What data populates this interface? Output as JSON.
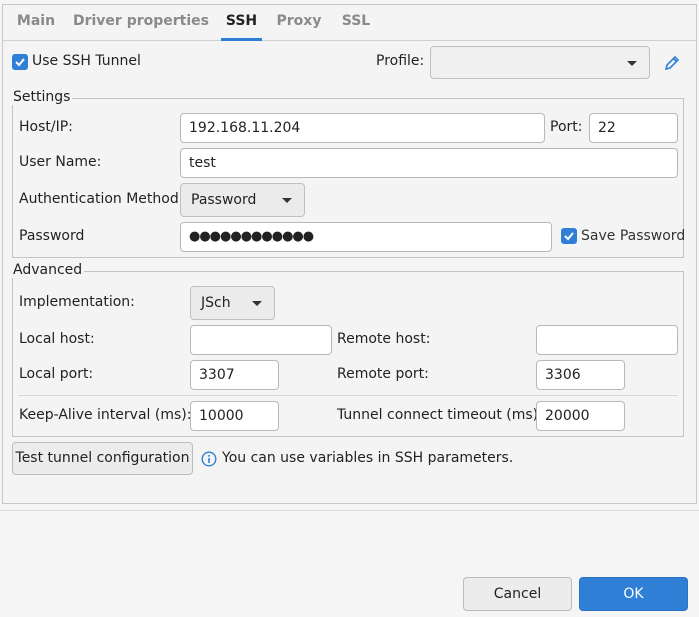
{
  "tabs": [
    {
      "label": "Main"
    },
    {
      "label": "Driver properties"
    },
    {
      "label": "SSH"
    },
    {
      "label": "Proxy"
    },
    {
      "label": "SSL"
    }
  ],
  "active_tab": "SSH",
  "use_ssh_tunnel": {
    "label": "Use SSH Tunnel",
    "checked": true
  },
  "profile": {
    "label": "Profile:",
    "value": ""
  },
  "settings": {
    "legend": "Settings",
    "host_label": "Host/IP:",
    "host_value": "192.168.11.204",
    "port_label": "Port:",
    "port_value": "22",
    "user_label": "User Name:",
    "user_value": "test",
    "auth_label": "Authentication Method:",
    "auth_value": "Password",
    "password_label": "Password",
    "password_mask": "●●●●●●●●●●●●",
    "save_password_label": "Save Password",
    "save_password_checked": true
  },
  "advanced": {
    "legend": "Advanced",
    "implementation_label": "Implementation:",
    "implementation_value": "JSch",
    "local_host_label": "Local host:",
    "local_host_value": "",
    "remote_host_label": "Remote host:",
    "remote_host_value": "",
    "local_port_label": "Local port:",
    "local_port_value": "3307",
    "remote_port_label": "Remote port:",
    "remote_port_value": "3306",
    "keepalive_label": "Keep-Alive interval (ms):",
    "keepalive_value": "10000",
    "timeout_label": "Tunnel connect timeout (ms):",
    "timeout_value": "20000"
  },
  "test_button": "Test tunnel configuration",
  "info_text": "You can use variables in SSH parameters.",
  "footer": {
    "cancel": "Cancel",
    "ok": "OK"
  },
  "colors": {
    "accent": "#2f7fd6"
  }
}
